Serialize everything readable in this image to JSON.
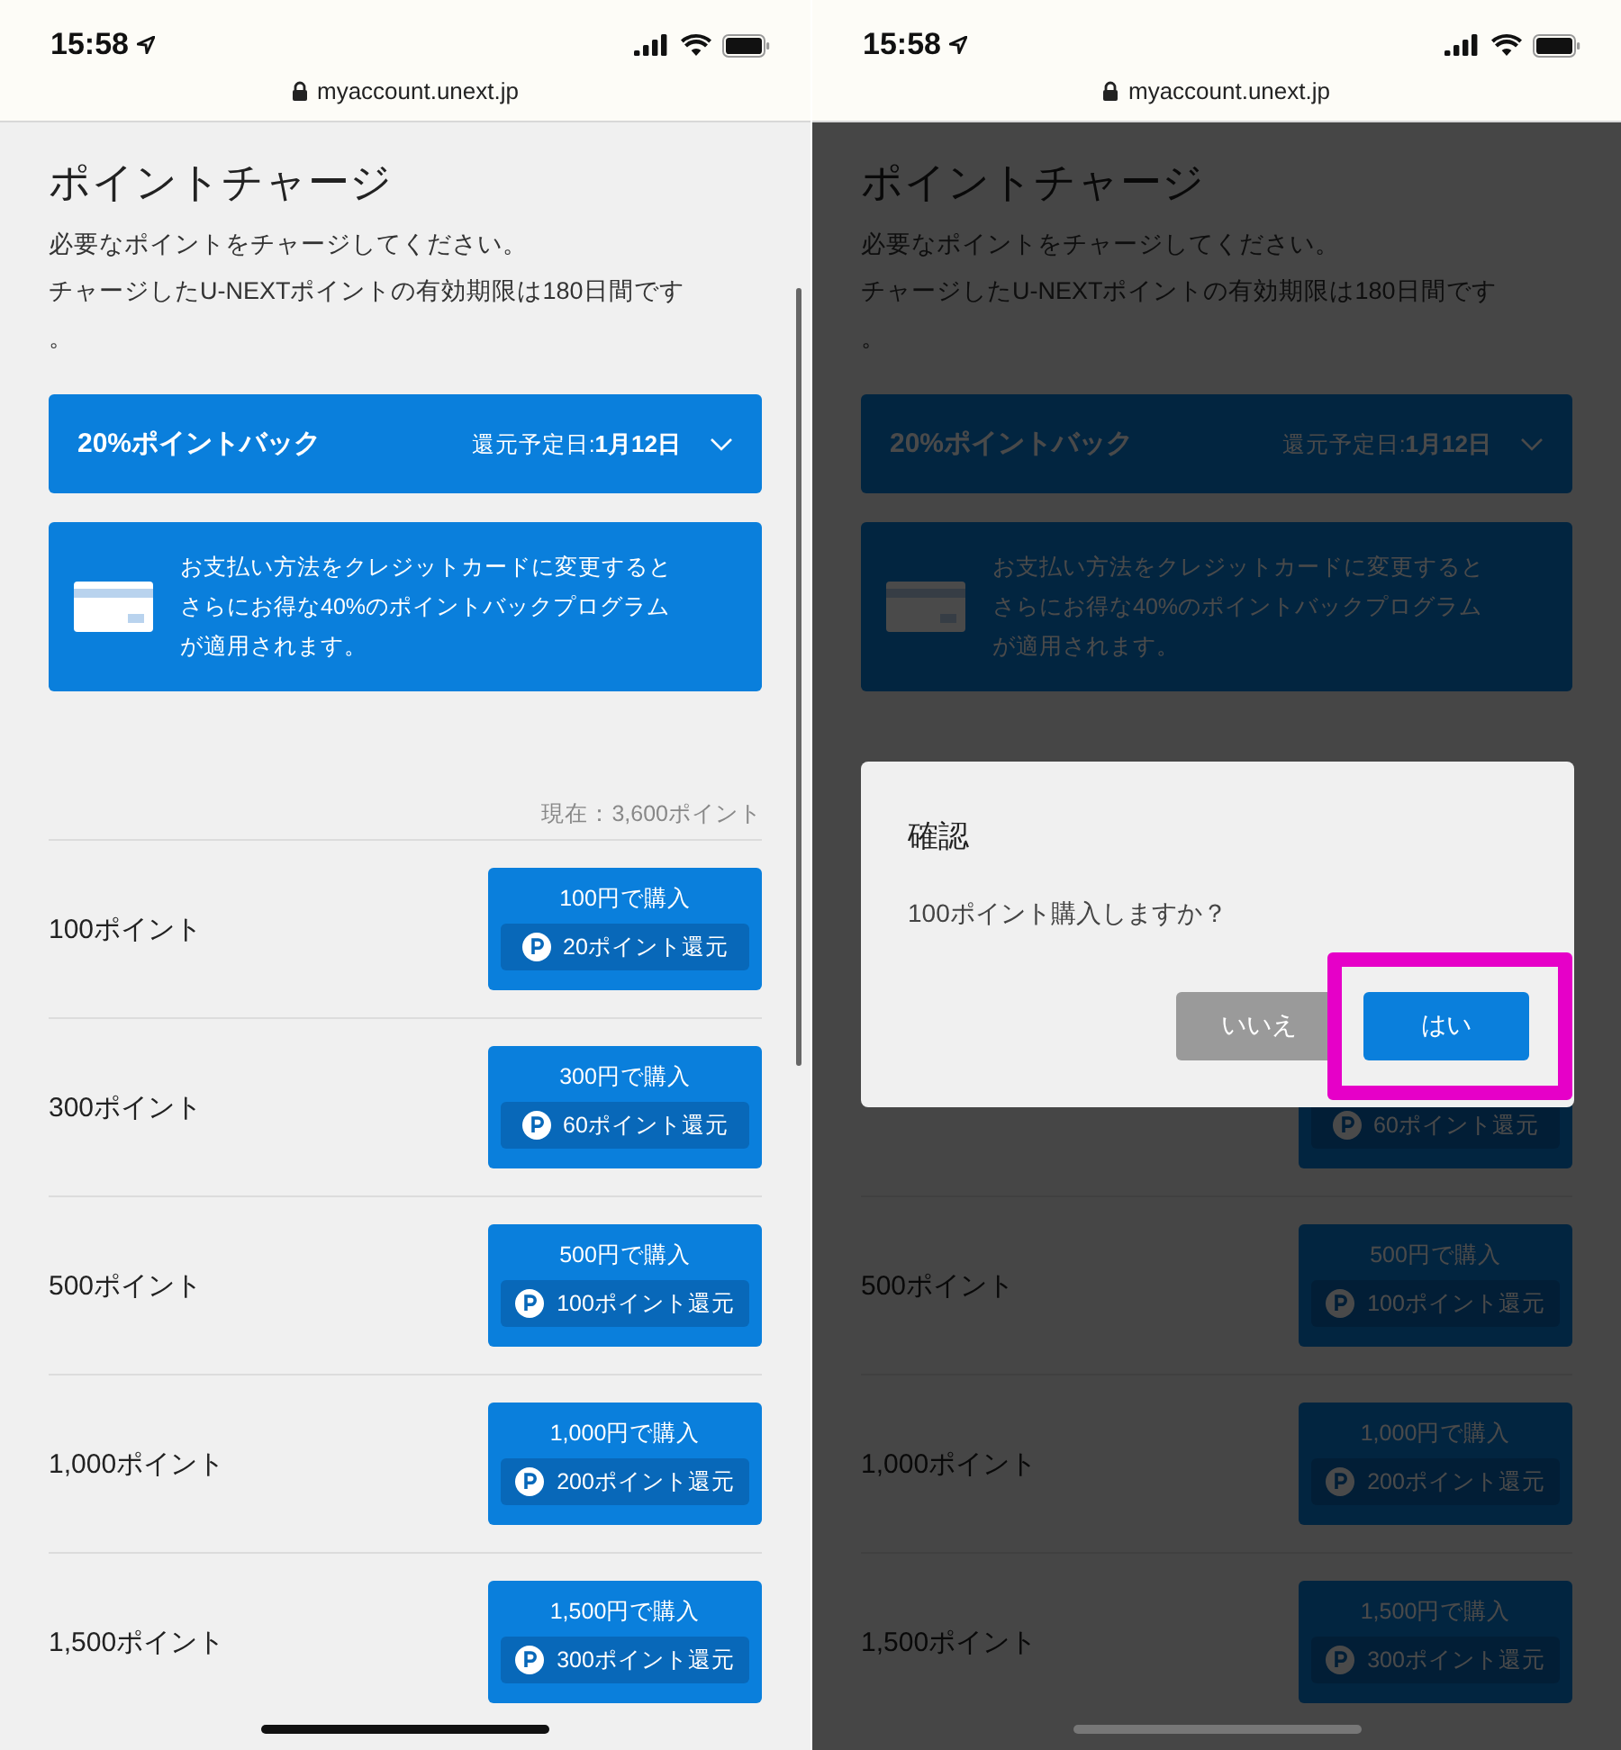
{
  "screens": [
    {
      "status_bar": {
        "time": "15:58"
      },
      "url": "myaccount.unext.jp",
      "dimmed": false,
      "scrollbar": true,
      "title": "ポイントチャージ",
      "description": [
        "必要なポイントをチャージしてください。",
        "チャージしたU-NEXTポイントの有効期限は180日間です",
        "。"
      ],
      "banner": {
        "title": "20%ポイントバック",
        "date_label": "還元予定日:",
        "date": "1月12日"
      },
      "info": "お支払い方法をクレジットカードに変更するとさらにお得な40%のポイントバックプログラムが適用されます。",
      "balance": "現在：3,600ポイント",
      "rows": [
        {
          "label": "100ポイント",
          "price": "100円で購入",
          "bonus": "20ポイント還元"
        },
        {
          "label": "300ポイント",
          "price": "300円で購入",
          "bonus": "60ポイント還元"
        },
        {
          "label": "500ポイント",
          "price": "500円で購入",
          "bonus": "100ポイント還元"
        },
        {
          "label": "1,000ポイント",
          "price": "1,000円で購入",
          "bonus": "200ポイント還元"
        },
        {
          "label": "1,500ポイント",
          "price": "1,500円で購入",
          "bonus": "300ポイント還元"
        }
      ]
    },
    {
      "status_bar": {
        "time": "15:58"
      },
      "url": "myaccount.unext.jp",
      "dimmed": true,
      "scrollbar": false,
      "title": "ポイントチャージ",
      "description": [
        "必要なポイントをチャージしてください。",
        "チャージしたU-NEXTポイントの有効期限は180日間です",
        "。"
      ],
      "banner": {
        "title": "20%ポイントバック",
        "date_label": "還元予定日:",
        "date": "1月12日"
      },
      "info": "お支払い方法をクレジットカードに変更するとさらにお得な40%のポイントバックプログラムが適用されます。",
      "rows": [
        {
          "bonus": "60ポイント還元"
        },
        {
          "label": "500ポイント",
          "price": "500円で購入",
          "bonus": "100ポイント還元"
        },
        {
          "label": "1,000ポイント",
          "price": "1,000円で購入",
          "bonus": "200ポイント還元"
        },
        {
          "label": "1,500ポイント",
          "price": "1,500円で購入",
          "bonus": "300ポイント還元"
        }
      ],
      "dialog": {
        "title": "確認",
        "message": "100ポイント購入しますか？",
        "buttons": [
          {
            "kind": "cancel",
            "label": "いいえ",
            "highlighted": false
          },
          {
            "kind": "confirm",
            "label": "はい",
            "highlighted": true
          }
        ]
      }
    }
  ]
}
